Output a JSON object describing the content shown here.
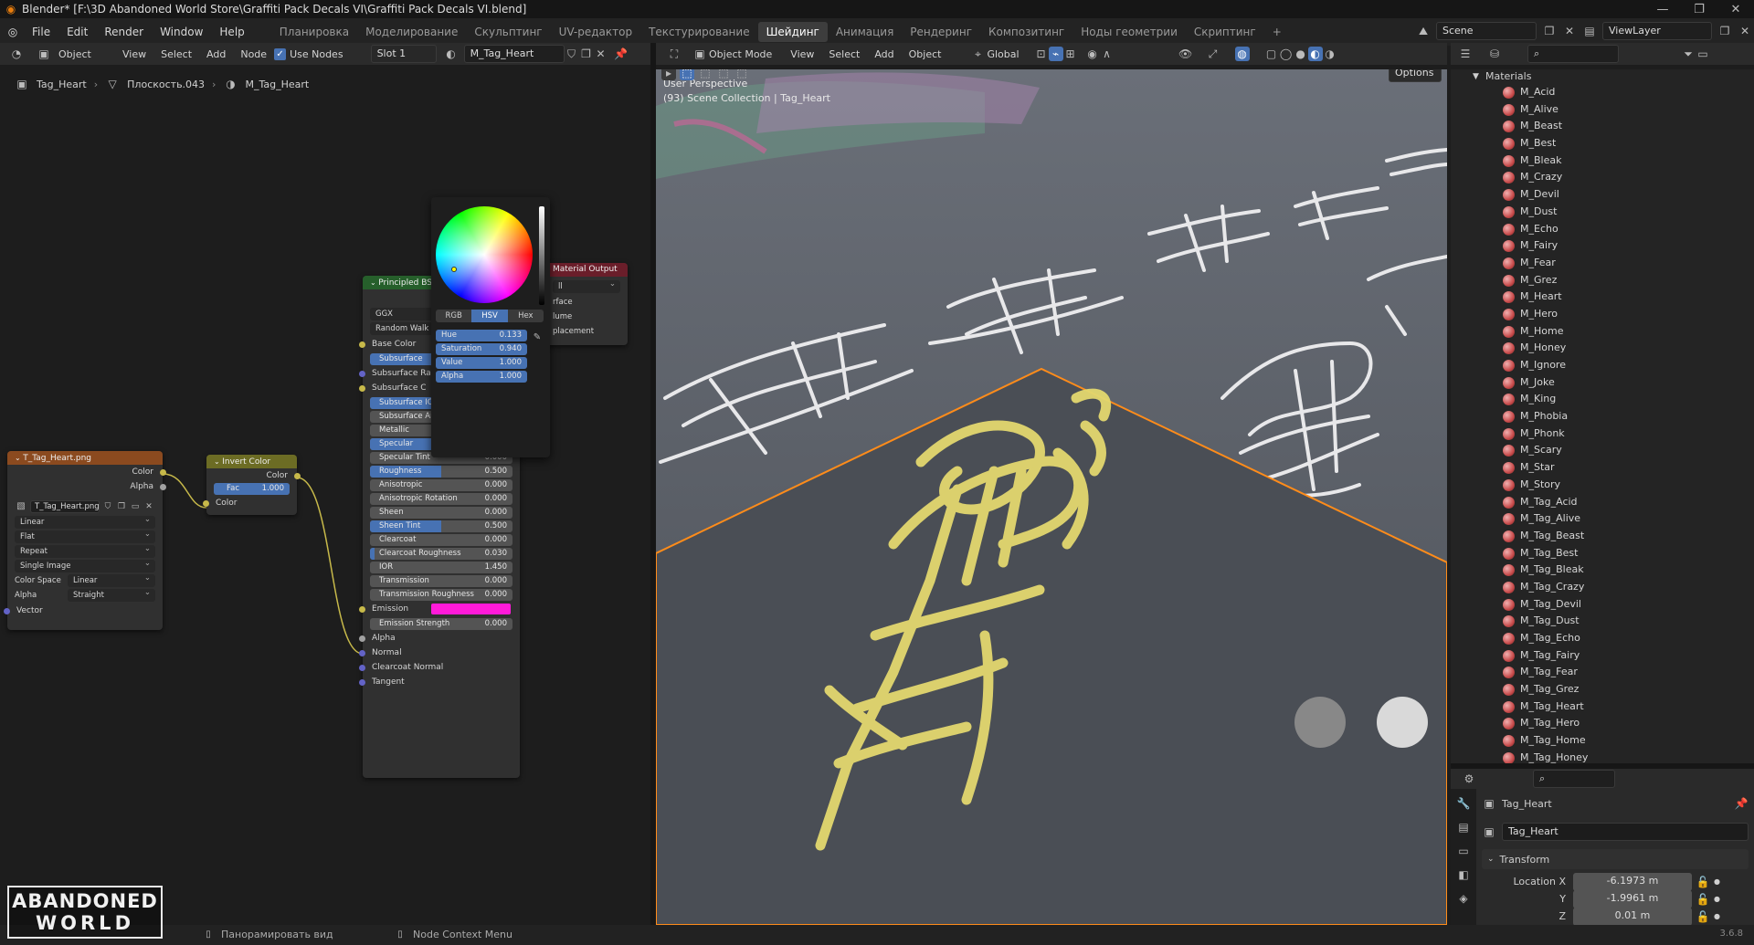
{
  "window": {
    "title": "Blender* [F:\\3D Abandoned World Store\\Graffiti Pack Decals VI\\Graffiti Pack Decals VI.blend]"
  },
  "menu": [
    "File",
    "Edit",
    "Render",
    "Window",
    "Help"
  ],
  "workspaces": [
    "Планировка",
    "Моделирование",
    "Скульптинг",
    "UV-редактор",
    "Текстурирование",
    "Шейдинг",
    "Анимация",
    "Рендеринг",
    "Композитинг",
    "Ноды геометрии",
    "Скриптинг"
  ],
  "active_workspace": "Шейдинг",
  "scene": {
    "name": "Scene",
    "view_layer": "ViewLayer"
  },
  "node_header": {
    "mode": "Object",
    "view": "View",
    "select": "Select",
    "add": "Add",
    "node": "Node",
    "use_nodes": "Use Nodes",
    "slot": "Slot 1",
    "material": "M_Tag_Heart"
  },
  "breadcrumb": [
    "Tag_Heart",
    "Плоскость.043",
    "M_Tag_Heart"
  ],
  "image_node": {
    "title": "T_Tag_Heart.png",
    "out_color": "Color",
    "out_alpha": "Alpha",
    "image": "T_Tag_Heart.png",
    "interpolation": "Linear",
    "projection": "Flat",
    "extension": "Repeat",
    "source": "Single Image",
    "color_space_label": "Color Space",
    "color_space": "Linear",
    "alpha_label": "Alpha",
    "alpha": "Straight",
    "in_vector": "Vector"
  },
  "invert_node": {
    "title": "Invert Color",
    "out_color": "Color",
    "fac_label": "Fac",
    "fac": "1.000",
    "fac_value": 1.0,
    "in_color": "Color"
  },
  "bsdf_node": {
    "title": "Principled BSDF",
    "distribution": "GGX",
    "subsurface_method": "Random Walk",
    "base_color": "Base Color",
    "subsurface": "Subsurface",
    "subsurface_radius": "Subsurface Radius",
    "subsurface_color": "Subsurface Co...",
    "sliders": [
      {
        "label": "Subsurface IOR",
        "value": "1.400",
        "fill": 1.0
      },
      {
        "label": "Subsurface Anisotropy",
        "value": "0.000",
        "fill": 0.0
      },
      {
        "label": "Metallic",
        "value": "0.000",
        "fill": 0.0
      },
      {
        "label": "Specular",
        "value": "0.500",
        "fill": 0.5
      },
      {
        "label": "Specular Tint",
        "value": "0.000",
        "fill": 0.0
      },
      {
        "label": "Roughness",
        "value": "0.500",
        "fill": 0.5
      },
      {
        "label": "Anisotropic",
        "value": "0.000",
        "fill": 0.0
      },
      {
        "label": "Anisotropic Rotation",
        "value": "0.000",
        "fill": 0.0
      },
      {
        "label": "Sheen",
        "value": "0.000",
        "fill": 0.0
      },
      {
        "label": "Sheen Tint",
        "value": "0.500",
        "fill": 0.5
      },
      {
        "label": "Clearcoat",
        "value": "0.000",
        "fill": 0.0
      },
      {
        "label": "Clearcoat Roughness",
        "value": "0.030",
        "fill": 0.03
      },
      {
        "label": "IOR",
        "value": "1.450",
        "fill": 0.0
      },
      {
        "label": "Transmission",
        "value": "0.000",
        "fill": 0.0
      },
      {
        "label": "Transmission Roughness",
        "value": "0.000",
        "fill": 0.0
      }
    ],
    "emission": "Emission",
    "emission_strength": {
      "label": "Emission Strength",
      "value": "0.000"
    },
    "alpha": "Alpha",
    "normal": "Normal",
    "clearcoat_normal": "Clearcoat Normal",
    "tangent": "Tangent",
    "colors": {
      "subsurface_color": "#f5e437",
      "emission": "#ff1ad9"
    }
  },
  "output_node": {
    "title": "Material Output",
    "target": "ll",
    "surface": "rface",
    "volume": "lume",
    "displacement": "placement"
  },
  "color_picker": {
    "tabs": [
      "RGB",
      "HSV",
      "Hex"
    ],
    "active_tab": "HSV",
    "fields": [
      {
        "label": "Hue",
        "value": "0.133"
      },
      {
        "label": "Saturation",
        "value": "0.940"
      },
      {
        "label": "Value",
        "value": "1.000"
      },
      {
        "label": "Alpha",
        "value": "1.000"
      }
    ]
  },
  "viewport_header": {
    "mode": "Object Mode",
    "view": "View",
    "select": "Select",
    "add": "Add",
    "object": "Object",
    "orientation": "Global",
    "options": "Options"
  },
  "viewport_overlay": {
    "line1": "User Perspective",
    "line2": "(93) Scene Collection | Tag_Heart"
  },
  "outliner": {
    "category": "Materials",
    "items": [
      "M_Acid",
      "M_Alive",
      "M_Beast",
      "M_Best",
      "M_Bleak",
      "M_Crazy",
      "M_Devil",
      "M_Dust",
      "M_Echo",
      "M_Fairy",
      "M_Fear",
      "M_Grez",
      "M_Heart",
      "M_Hero",
      "M_Home",
      "M_Honey",
      "M_Ignore",
      "M_Joke",
      "M_King",
      "M_Phobia",
      "M_Phonk",
      "M_Scary",
      "M_Star",
      "M_Story",
      "M_Tag_Acid",
      "M_Tag_Alive",
      "M_Tag_Beast",
      "M_Tag_Best",
      "M_Tag_Bleak",
      "M_Tag_Crazy",
      "M_Tag_Devil",
      "M_Tag_Dust",
      "M_Tag_Echo",
      "M_Tag_Fairy",
      "M_Tag_Fear",
      "M_Tag_Grez",
      "M_Tag_Heart",
      "M_Tag_Hero",
      "M_Tag_Home",
      "M_Tag_Honey"
    ]
  },
  "properties": {
    "object_name": "Tag_Heart",
    "data_name": "Tag_Heart",
    "panel": "Transform",
    "location_x_label": "Location X",
    "location_x": "-6.1973 m",
    "y_label": "Y",
    "location_y": "-1.9961 m",
    "z_label": "Z",
    "location_z": "0.01 m"
  },
  "status": {
    "pan": "Панорамировать вид",
    "context": "Node Context Menu",
    "version": "3.6.8"
  },
  "logo": {
    "line1": "ABANDONED",
    "line2": "WORLD"
  }
}
